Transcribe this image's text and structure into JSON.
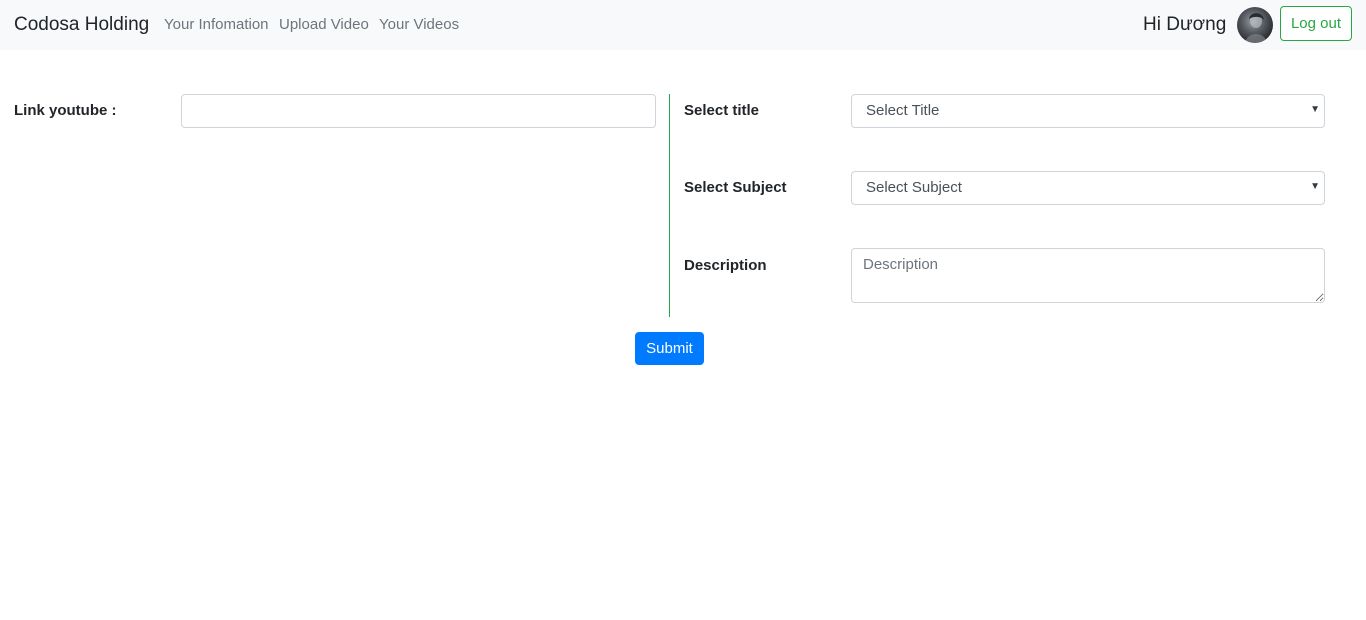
{
  "navbar": {
    "brand": "Codosa Holding",
    "links": [
      {
        "label": "Your Infomation"
      },
      {
        "label": "Upload Video"
      },
      {
        "label": "Your Videos"
      }
    ],
    "greeting": "Hi Dương",
    "logout_label": "Log out"
  },
  "form": {
    "link_label": "Link youtube :",
    "link_value": "",
    "title_label": "Select title",
    "title_selected": "Select Title",
    "subject_label": "Select Subject",
    "subject_selected": "Select Subject",
    "description_label": "Description",
    "description_placeholder": "Description",
    "submit_label": "Submit"
  },
  "colors": {
    "primary": "#007bff",
    "success": "#28a745",
    "navbar_bg": "#f8f9fa"
  }
}
